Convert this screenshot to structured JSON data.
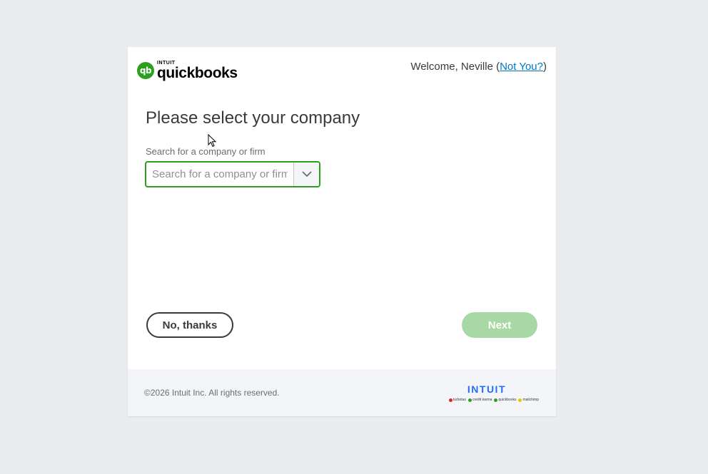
{
  "header": {
    "logo_intuit": "INTUIT",
    "logo_word": "quickbooks",
    "logo_badge": "qb",
    "welcome_prefix": "Welcome, Neville (",
    "not_you_link": "Not You?",
    "welcome_suffix": ")"
  },
  "main": {
    "title": "Please select your company",
    "search_label": "Search for a company or firm",
    "search_placeholder": "Search for a company or firm",
    "search_value": ""
  },
  "actions": {
    "no_thanks": "No, thanks",
    "next": "Next"
  },
  "footer": {
    "copyright": "©2026 Intuit Inc. All rights reserved.",
    "intuit_brand": "INTUIT",
    "brands": [
      {
        "name": "turbotax",
        "color": "#d52b1e"
      },
      {
        "name": "credit karma",
        "color": "#2ca01c"
      },
      {
        "name": "quickbooks",
        "color": "#2ca01c"
      },
      {
        "name": "mailchimp",
        "color": "#ffe01b"
      }
    ]
  },
  "colors": {
    "accent": "#2ca01c",
    "link": "#0077c5",
    "next_disabled": "#a8d8a3",
    "intuit_blue": "#236cff"
  }
}
